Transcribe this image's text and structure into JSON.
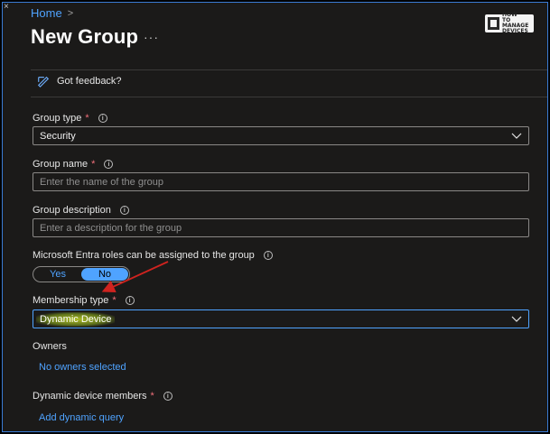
{
  "breadcrumb": {
    "home": "Home",
    "chevron": ">"
  },
  "header": {
    "title": "New Group",
    "more": "···"
  },
  "logo": {
    "line1": "HOW",
    "line2": "TO",
    "line3": "MANAGE",
    "line4": "DEVICES"
  },
  "feedback": {
    "label": "Got feedback?"
  },
  "form": {
    "group_type": {
      "label": "Group type",
      "required": "*",
      "value": "Security"
    },
    "group_name": {
      "label": "Group name",
      "required": "*",
      "placeholder": "Enter the name of the group"
    },
    "group_description": {
      "label": "Group description",
      "placeholder": "Enter a description for the group"
    },
    "entra_roles": {
      "label": "Microsoft Entra roles can be assigned to the group",
      "yes": "Yes",
      "no": "No",
      "selected": "No"
    },
    "membership_type": {
      "label": "Membership type",
      "required": "*",
      "value": "Dynamic Device"
    },
    "owners": {
      "label": "Owners",
      "link": "No owners selected"
    },
    "dynamic_members": {
      "label": "Dynamic device members",
      "required": "*",
      "link": "Add dynamic query"
    }
  },
  "icons": {
    "info": "i"
  },
  "colors": {
    "accent": "#4fa3ff",
    "required": "#f1707b",
    "annotation_arrow": "#d0231f",
    "highlight": "#c8dc28"
  }
}
